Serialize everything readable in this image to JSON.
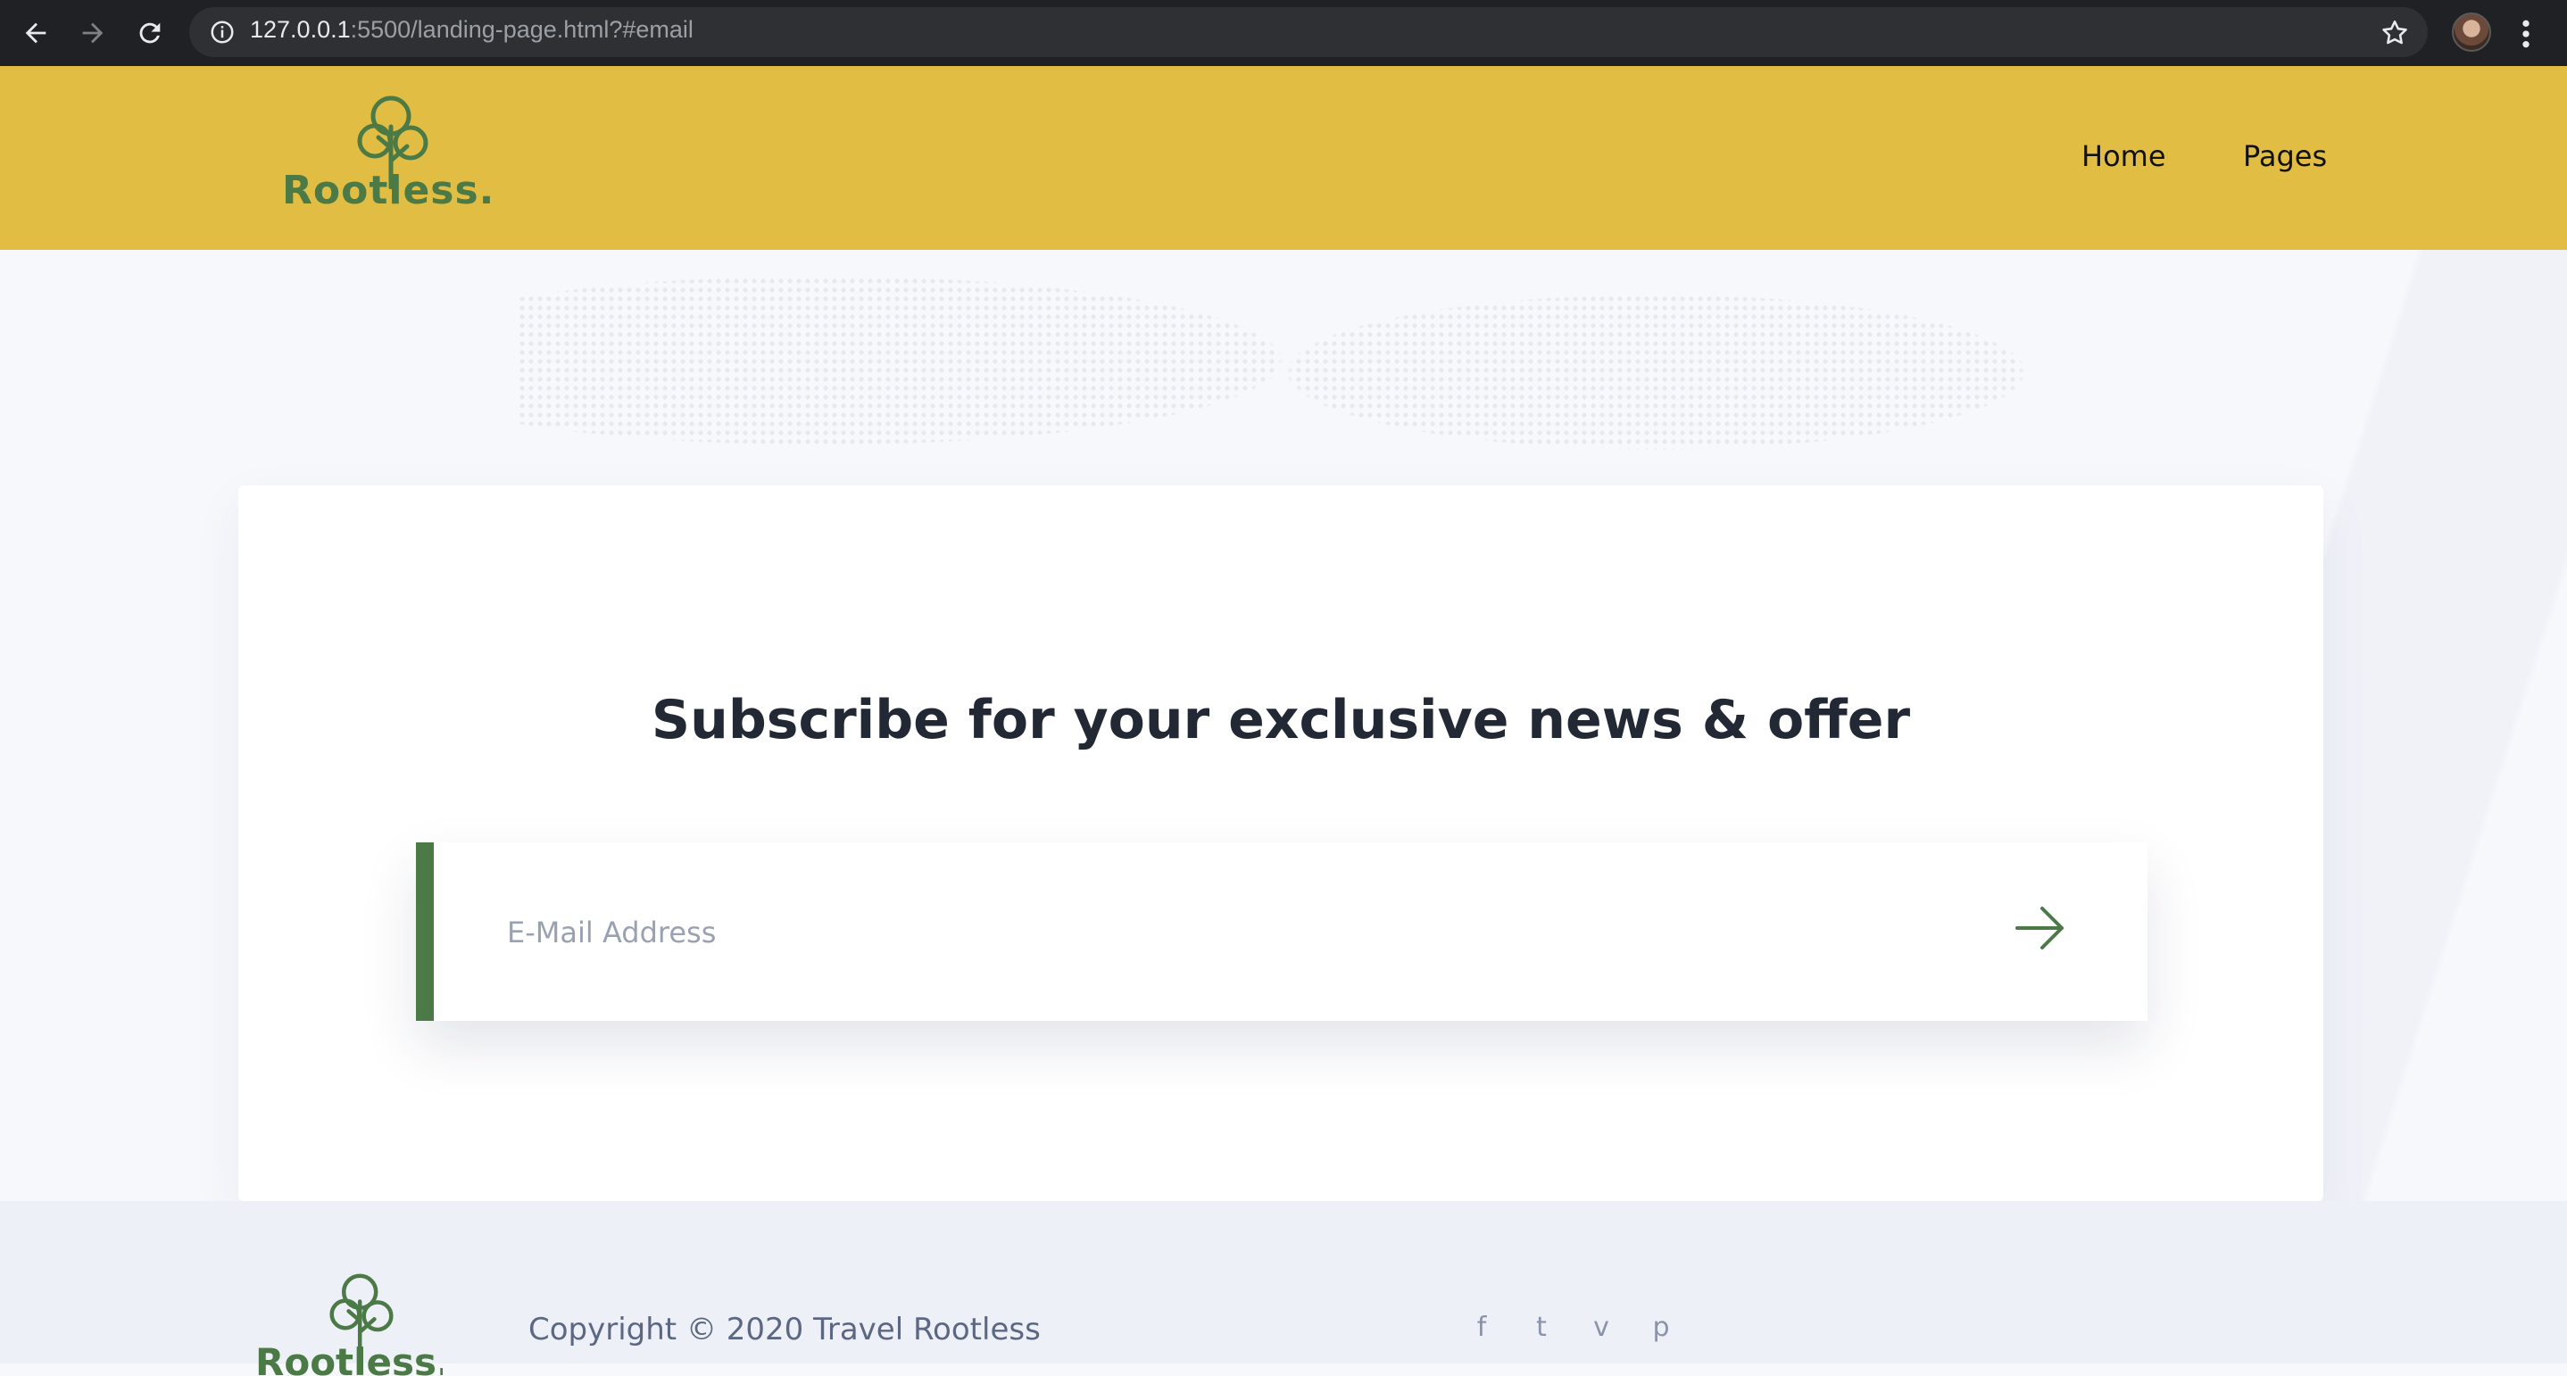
{
  "browser": {
    "url_host": "127.0.0.1",
    "url_rest": ":5500/landing-page.html?#email",
    "icons": [
      "back-icon",
      "forward-icon",
      "reload-icon",
      "info-icon",
      "star-icon",
      "profile-avatar",
      "menu-icon"
    ]
  },
  "header": {
    "logo_text": "Rootless.",
    "nav": [
      {
        "label": "Home"
      },
      {
        "label": "Pages"
      }
    ]
  },
  "subscribe": {
    "title": "Subscribe for your exclusive news & offer",
    "email_placeholder": "E-Mail Address",
    "submit_icon": "arrow-right-icon",
    "accent_color": "#4b7a47"
  },
  "footer": {
    "logo_text": "Rootless.",
    "copyright": "Copyright © 2020 Travel Rootless",
    "social": [
      {
        "name": "facebook-icon",
        "glyph": "f"
      },
      {
        "name": "twitter-icon",
        "glyph": "t"
      },
      {
        "name": "vimeo-icon",
        "glyph": "v"
      },
      {
        "name": "pinterest-icon",
        "glyph": "p"
      }
    ]
  },
  "colors": {
    "header_bg": "#e1be43",
    "brand_green": "#4b7a47",
    "page_bg": "#f7f8fc",
    "footer_bg": "#eef0f7"
  }
}
